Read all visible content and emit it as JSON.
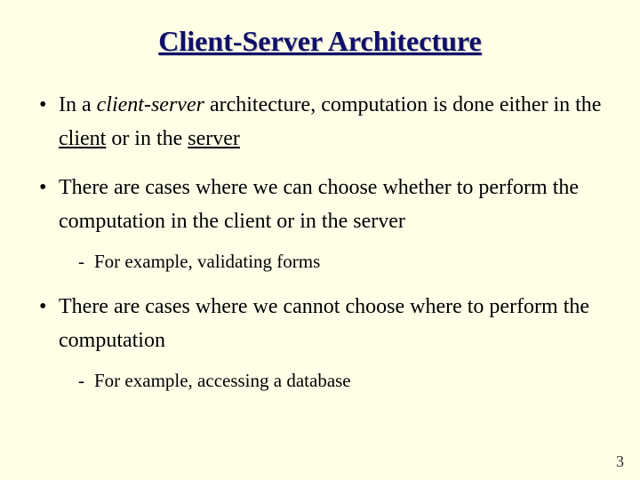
{
  "title": "Client-Server Architecture",
  "bullets": {
    "b1": {
      "pre": "In a ",
      "emph": "client-server",
      "mid": " architecture, computation is done either in the ",
      "u1": "client",
      "mid2": " or in the ",
      "u2": "server"
    },
    "b2": {
      "text": "There are cases where we can choose whether to perform the computation in the client or in the server",
      "sub": "For example, validating forms"
    },
    "b3": {
      "text": "There are cases where we cannot choose where to perform the computation",
      "sub": "For example, accessing a database"
    }
  },
  "page_number": "3"
}
